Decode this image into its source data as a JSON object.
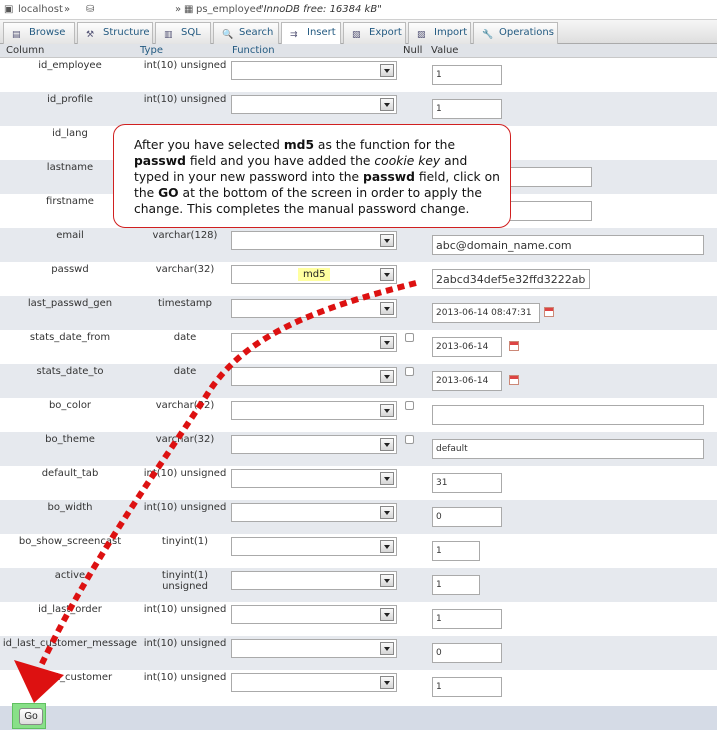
{
  "breadcrumb": {
    "server": "localhost",
    "sep1": "»",
    "sep2": "»",
    "table": "ps_employee",
    "info": "\"InnoDB free: 16384 kB\""
  },
  "tabs": [
    {
      "label": "Browse",
      "icon": "browse-icon"
    },
    {
      "label": "Structure",
      "icon": "structure-icon"
    },
    {
      "label": "SQL",
      "icon": "sql-icon"
    },
    {
      "label": "Search",
      "icon": "search-icon"
    },
    {
      "label": "Insert",
      "icon": "insert-icon"
    },
    {
      "label": "Export",
      "icon": "export-icon"
    },
    {
      "label": "Import",
      "icon": "import-icon"
    },
    {
      "label": "Operations",
      "icon": "operations-icon"
    }
  ],
  "columns": {
    "column": "Column",
    "type": "Type",
    "function": "Function",
    "null": "Null",
    "value": "Value"
  },
  "rows": [
    {
      "name": "id_employee",
      "type": "int(10) unsigned",
      "value": "1"
    },
    {
      "name": "id_profile",
      "type": "int(10) unsigned",
      "value": "1"
    },
    {
      "name": "id_lang",
      "type": "",
      "value": ""
    },
    {
      "name": "lastname",
      "type": "",
      "value": ""
    },
    {
      "name": "firstname",
      "type": "",
      "value": ""
    },
    {
      "name": "email",
      "type": "varchar(128)",
      "value": "abc@domain_name.com"
    },
    {
      "name": "passwd",
      "type": "varchar(32)",
      "function": "md5",
      "value": "2abcd34def5e32ffd3222ab"
    },
    {
      "name": "last_passwd_gen",
      "type": "timestamp",
      "value": "2013-06-14 08:47:31"
    },
    {
      "name": "stats_date_from",
      "type": "date",
      "value": "2013-06-14"
    },
    {
      "name": "stats_date_to",
      "type": "date",
      "value": "2013-06-14"
    },
    {
      "name": "bo_color",
      "type": "varchar(32)",
      "value": ""
    },
    {
      "name": "bo_theme",
      "type": "varchar(32)",
      "value": "default"
    },
    {
      "name": "default_tab",
      "type": "int(10) unsigned",
      "value": "31"
    },
    {
      "name": "bo_width",
      "type": "int(10) unsigned",
      "value": "0"
    },
    {
      "name": "bo_show_screencast",
      "type": "tinyint(1)",
      "value": "1"
    },
    {
      "name": "active",
      "type": "tinyint(1) unsigned",
      "value": "1"
    },
    {
      "name": "id_last_order",
      "type": "int(10) unsigned",
      "value": "1"
    },
    {
      "name": "id_last_customer_message",
      "type": "int(10) unsigned",
      "value": "0"
    },
    {
      "name": "id_last_customer",
      "type": "int(10) unsigned",
      "value": "1"
    }
  ],
  "callout": {
    "p1": "After you have selected ",
    "b1": "md5",
    "p2": " as the function for the ",
    "b2": "passwd",
    "p3": " field and you have added the ",
    "i1": "cookie key",
    "p4": " and typed in your new password into the ",
    "b3": "passwd",
    "p5": " field, click on the ",
    "b4": "GO",
    "p6": " at the bottom of the screen in order to apply the change.  This completes the manual password change."
  },
  "go_label": "Go",
  "colors": {
    "callout_border": "#d02020",
    "arrow": "#dd1111",
    "go_highlight": "#88e088",
    "function_highlight": "#ffffa0",
    "tab_text": "#235a81"
  }
}
